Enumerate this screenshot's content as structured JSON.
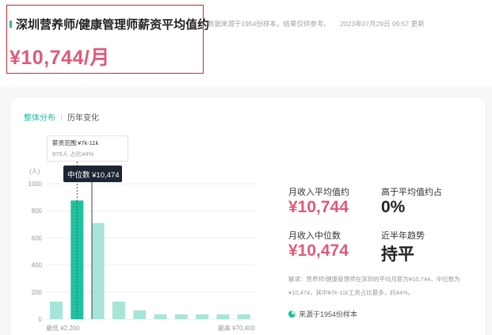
{
  "header": {
    "title": "深圳营养师/健康管理师薪资平均值约",
    "average_display": "¥10,744/月",
    "meta_note": "数据来源于1954份样本，结果仅供参考。",
    "updated": "2023年07月29日 09:57 更新"
  },
  "tabs": [
    {
      "label": "整体分布",
      "active": true
    },
    {
      "label": "历年变化",
      "active": false
    }
  ],
  "tooltip": {
    "range_label": "薪资范围:¥7k-11k",
    "detail": "876人 占比44%"
  },
  "median_tag": "中位数 ¥10,474",
  "stats": {
    "avg_label": "月收入平均值约",
    "avg_value": "¥10,744",
    "above_avg_label": "高于平均值约占",
    "above_avg_value": "0%",
    "median_label": "月收入中位数",
    "median_value": "¥10,474",
    "trend_label": "近半年趋势",
    "trend_value": "持平"
  },
  "note": "解读：营养师/健康管理师在深圳的平均月薪为¥10,744，中位数为¥10,474，其中¥7k-11k工资占比最多，约44%。",
  "source": "来源于1954份样本",
  "chart_data": {
    "type": "bar",
    "ylabel": "(人)",
    "ylim": [
      0,
      1000
    ],
    "yticks": [
      0,
      200,
      400,
      600,
      800,
      1000
    ],
    "values": [
      130,
      876,
      710,
      130,
      65,
      35,
      35,
      35,
      35,
      35
    ],
    "highlight_index": 1,
    "median_value": 10474,
    "min_label": "最低 ¥2,200",
    "max_label": "最高 ¥70,400",
    "colors": {
      "bar": "#a6e5d8",
      "highlight": "#1fc29e",
      "grid": "#eeeeee",
      "axis_text": "#999999"
    }
  }
}
